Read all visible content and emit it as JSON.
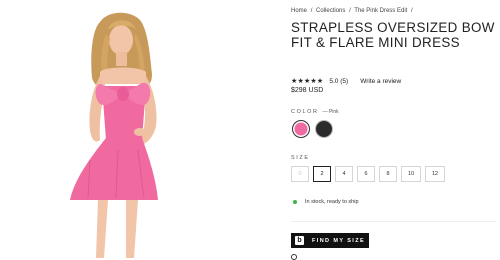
{
  "breadcrumb": {
    "items": [
      "Home",
      "/",
      "Collections",
      "/",
      "The Pink Dress Edit",
      "/"
    ]
  },
  "product": {
    "title": "STRAPLESS OVERSIZED BOW FIT & FLARE MINI DRESS",
    "stars": "★★★★★",
    "rating": "5.0 (5)",
    "review_link": "Write a review",
    "price": "$298 USD"
  },
  "color": {
    "label": "COLOR",
    "selected": "— Pink",
    "swatches": [
      {
        "name": "Pink",
        "hex": "#ef6aa1"
      },
      {
        "name": "Black",
        "hex": "#2b2b2b"
      }
    ]
  },
  "size": {
    "label": "SIZE",
    "options": [
      "0",
      "2",
      "4",
      "6",
      "8",
      "10",
      "12"
    ],
    "selected": "2",
    "unavailable": [
      "0"
    ]
  },
  "stock": {
    "text": "In stock, ready to ship",
    "color": "#3bb54a"
  },
  "find_my_size": {
    "label": "FIND MY SIZE",
    "icon": "b"
  },
  "colors": {
    "dress_pink": "#f06aa0",
    "skin": "#f2c5a8",
    "hair": "#c89a5a"
  }
}
